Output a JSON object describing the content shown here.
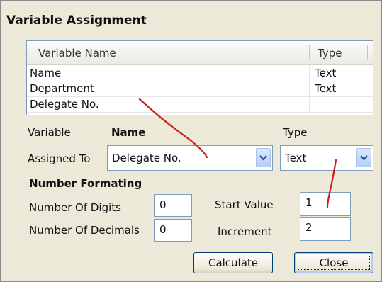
{
  "dialog": {
    "title": "Variable Assignment"
  },
  "variables_list": {
    "columns": [
      "Variable Name",
      "Type"
    ],
    "rows": [
      {
        "name": "Name",
        "type": "Text"
      },
      {
        "name": "Department",
        "type": "Text"
      },
      {
        "name": "Delegate No.",
        "type": ""
      }
    ]
  },
  "variable": {
    "label": "Variable",
    "value": "Name",
    "type_label": "Type"
  },
  "assigned": {
    "label": "Assigned To",
    "selected": "Delegate No.",
    "type_selected": "Text"
  },
  "number_format": {
    "heading": "Number Formating",
    "digits_label": "Number Of Digits",
    "digits_value": "0",
    "decimals_label": "Number Of Decimals",
    "decimals_value": "0",
    "start_label": "Start Value",
    "start_value": "1",
    "increment_label": "Increment",
    "increment_value": "2"
  },
  "buttons": {
    "calculate": "Calculate",
    "close": "Close"
  },
  "colors": {
    "dialog_bg": "#ece9d8",
    "annotation_red": "#c81e1e",
    "field_border": "#7f9db9"
  },
  "icons": {
    "dropdown": "chevron-down-icon"
  }
}
